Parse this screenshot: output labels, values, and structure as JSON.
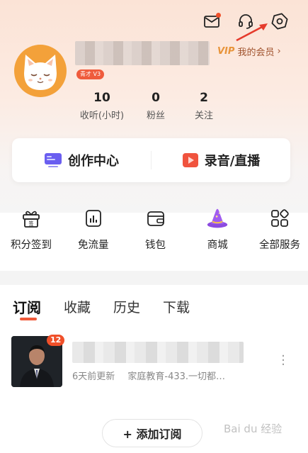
{
  "header": {
    "icons": [
      "mail-icon",
      "headset-icon",
      "settings-icon"
    ],
    "annotation": "red-arrow"
  },
  "profile": {
    "level_badge": "青才 V3",
    "vip_label": "VIP",
    "member_label": "我的会员",
    "member_chevron": "›",
    "stats": [
      {
        "value": "10",
        "label": "收听(小时)"
      },
      {
        "value": "0",
        "label": "粉丝"
      },
      {
        "value": "2",
        "label": "关注"
      }
    ]
  },
  "create": {
    "creation_center": "创作中心",
    "record_live": "录音/直播"
  },
  "services": [
    {
      "label": "积分签到",
      "icon": "gift-icon"
    },
    {
      "label": "免流量",
      "icon": "data-icon"
    },
    {
      "label": "钱包",
      "icon": "wallet-icon"
    },
    {
      "label": "商城",
      "icon": "wizard-hat-icon"
    },
    {
      "label": "全部服务",
      "icon": "grid-icon"
    }
  ],
  "tabs": [
    {
      "label": "订阅",
      "active": true
    },
    {
      "label": "收藏",
      "active": false
    },
    {
      "label": "历史",
      "active": false
    },
    {
      "label": "下载",
      "active": false
    }
  ],
  "subscription": {
    "count_badge": "12",
    "update_text": "6天前更新",
    "episode_text": "家庭教育-433.一切都…"
  },
  "add_subscription": "+ 添加订阅",
  "watermark": "Bai du 经验",
  "colors": {
    "accent": "#f05a3a",
    "vip_gold": "#e8943a",
    "member_brown": "#a0522d"
  }
}
